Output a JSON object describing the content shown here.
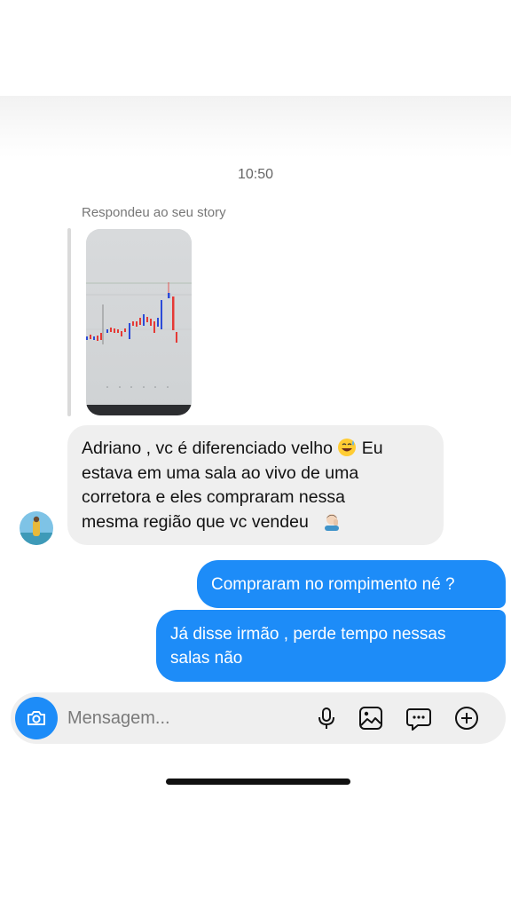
{
  "chat": {
    "time": "10:50",
    "reply_label": "Respondeu ao seu story",
    "incoming": {
      "line1": "Adriano , vc é diferenciado velho",
      "line1_suffix": "Eu",
      "line2": "estava em uma sala ao vivo de uma",
      "line3": "corretora e eles compraram nessa",
      "line4": "mesma região que vc vendeu",
      "emoji1": "sweat-smile-emoji",
      "emoji2": "man-facepalming-emoji"
    },
    "outgoing": [
      {
        "text": "Compraram no rompimento né ?"
      },
      {
        "line1": "Já disse irmão , perde tempo nessas",
        "line2": "salas não"
      }
    ]
  },
  "composer": {
    "placeholder": "Mensagem...",
    "icons": [
      "camera-icon",
      "microphone-icon",
      "gallery-icon",
      "sticker-icon",
      "add-icon"
    ]
  },
  "colors": {
    "accent": "#1d8cf8",
    "incoming_bubble": "#efefef",
    "background": "#ffffff"
  }
}
